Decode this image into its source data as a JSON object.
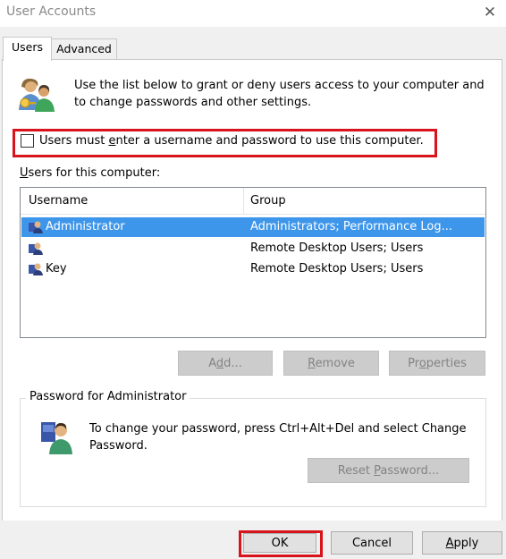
{
  "window": {
    "title": "User Accounts",
    "close_glyph": "✕"
  },
  "tabs": [
    {
      "label": "Users",
      "active": true
    },
    {
      "label": "Advanced",
      "active": false
    }
  ],
  "intro": {
    "icon": "users-icon",
    "text": "Use the list below to grant or deny users access to your computer and to change passwords and other settings."
  },
  "must_login": {
    "checked": false,
    "label_before": "Users must ",
    "label_underlined": "e",
    "label_after": "nter a username and password to use this computer."
  },
  "users_label": {
    "underlined": "U",
    "rest": "sers for this computer:"
  },
  "table": {
    "columns": [
      "Username",
      "Group"
    ],
    "rows": [
      {
        "username": "Administrator",
        "group": "Administrators; Performance Log...",
        "selected": true
      },
      {
        "username": "",
        "group": "Remote Desktop Users; Users",
        "selected": false
      },
      {
        "username": "Key",
        "group": "Remote Desktop Users; Users",
        "selected": false
      }
    ]
  },
  "list_buttons": {
    "add": {
      "before": "A",
      "u": "d",
      "after": "d..."
    },
    "remove": {
      "before": "",
      "u": "R",
      "after": "emove"
    },
    "properties": {
      "before": "Pr",
      "u": "o",
      "after": "perties"
    }
  },
  "password_box": {
    "title": "Password for Administrator",
    "icon": "user-key-icon",
    "text": "To change your password, press Ctrl+Alt+Del and select Change Password.",
    "reset_button": {
      "before": "Reset ",
      "u": "P",
      "after": "assword..."
    }
  },
  "footer": {
    "ok": "OK",
    "cancel": "Cancel",
    "apply_u": "A",
    "apply_rest": "pply"
  },
  "colors": {
    "highlight": "#d9131c",
    "selection": "#3e96ea"
  }
}
